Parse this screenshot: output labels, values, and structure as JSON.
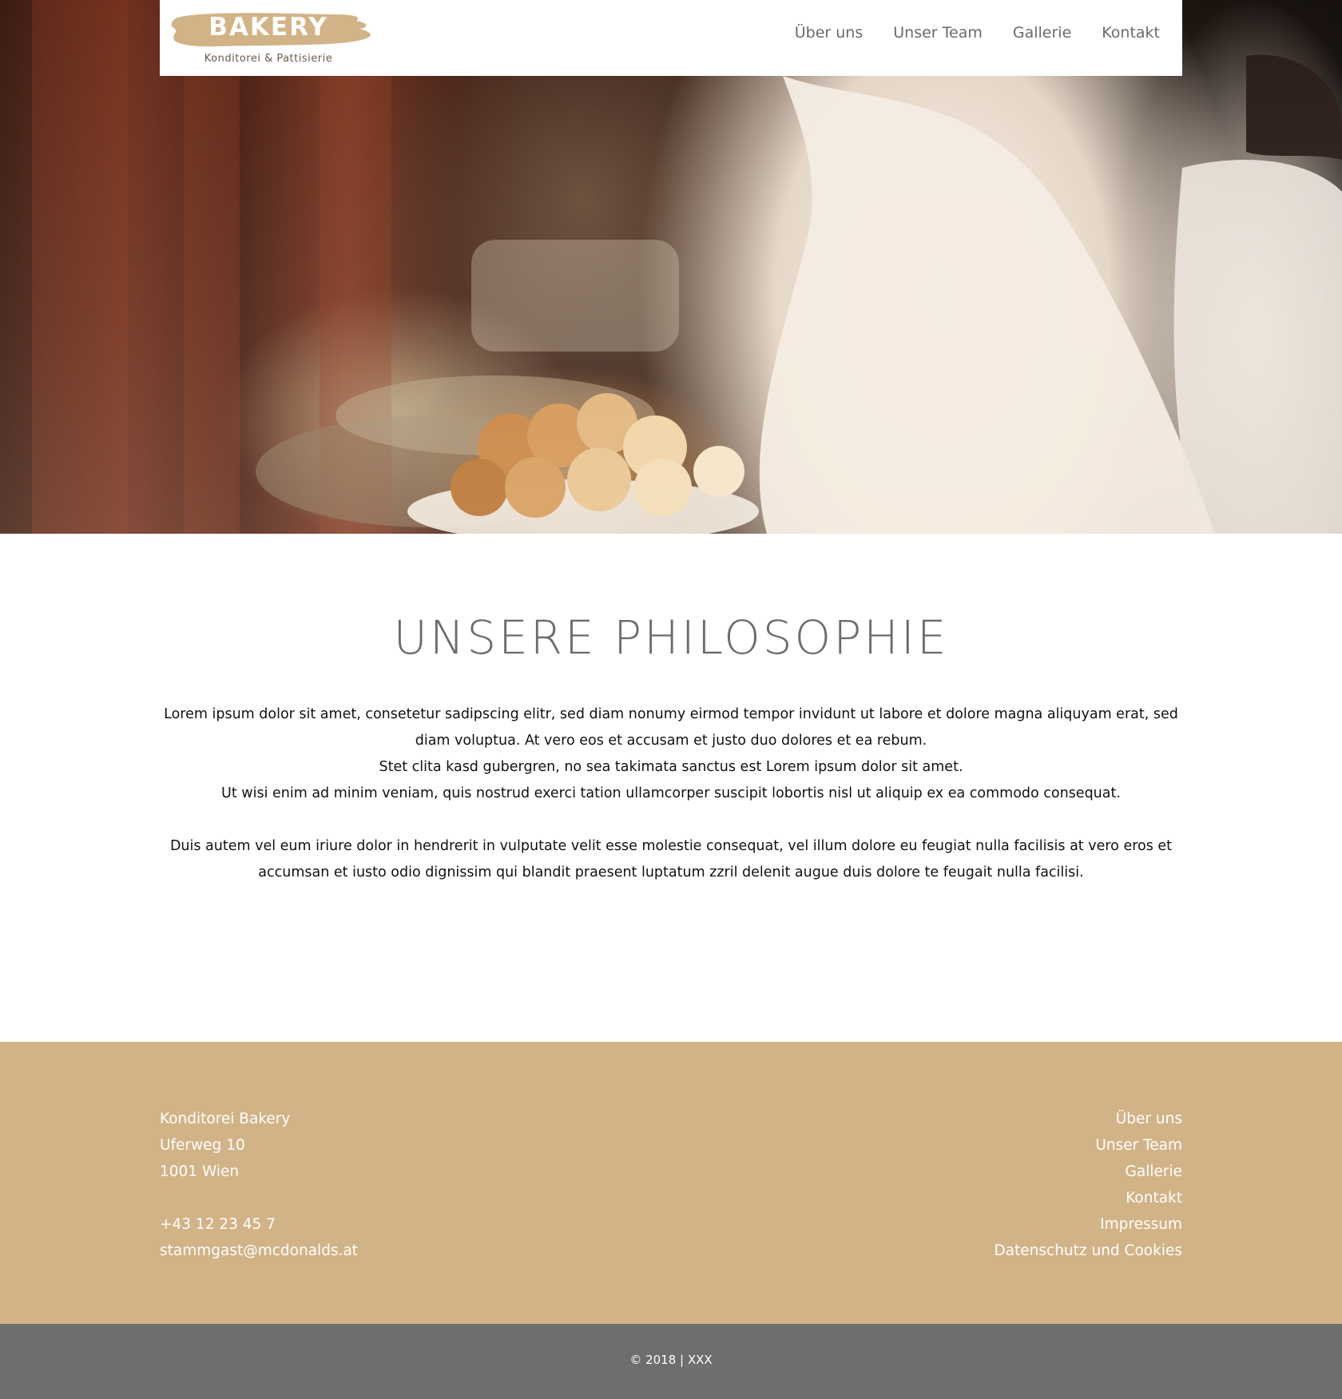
{
  "brand": {
    "name": "BAKERY",
    "tagline": "Konditorei & Pattisierie"
  },
  "nav": {
    "items": [
      {
        "label": "Über uns"
      },
      {
        "label": "Unser Team"
      },
      {
        "label": "Gallerie"
      },
      {
        "label": "Kontakt"
      }
    ]
  },
  "philosophy": {
    "title": "UNSERE PHILOSOPHIE",
    "lines": [
      "Lorem ipsum dolor sit amet, consetetur sadipscing elitr, sed diam nonumy eirmod tempor invidunt ut labore et dolore magna aliquyam erat, sed",
      "diam voluptua. At vero eos et accusam et justo duo dolores et ea rebum.",
      "Stet clita kasd gubergren, no sea takimata sanctus est Lorem ipsum dolor sit amet.",
      "Ut wisi enim ad minim veniam, quis nostrud exerci tation ullamcorper suscipit lobortis nisl ut aliquip ex ea commodo consequat."
    ],
    "paragraph2_lines": [
      "Duis autem vel eum iriure dolor in hendrerit in vulputate velit esse molestie consequat, vel illum dolore eu feugiat nulla facilisis at vero eros et",
      "accumsan et iusto odio dignissim qui blandit praesent luptatum zzril delenit augue duis dolore te feugait nulla facilisi."
    ]
  },
  "footer": {
    "address": {
      "company": "Konditorei Bakery",
      "street": "Uferweg 10",
      "city": "1001 Wien",
      "phone": "+43 12 23 45 7",
      "email": "stammgast@mcdonalds.at"
    },
    "links": [
      {
        "label": "Über uns"
      },
      {
        "label": "Unser Team"
      },
      {
        "label": "Gallerie"
      },
      {
        "label": "Kontakt"
      },
      {
        "label": "Impressum"
      },
      {
        "label": "Datenschutz und Cookies"
      }
    ],
    "copyright": "© 2018 | XXX"
  },
  "colors": {
    "accent": "#d2b387",
    "bottom_bar": "#6e6e6e",
    "heading": "#6c6c6c"
  },
  "hero": {
    "icon": "bakery-hero-image"
  }
}
